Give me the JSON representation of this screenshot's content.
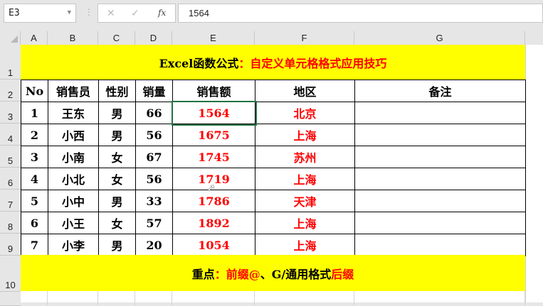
{
  "formula_bar": {
    "name_box": "E3",
    "cancel_icon": "✕",
    "enter_icon": "✓",
    "fx_label": "fx",
    "value": "1564"
  },
  "columns": [
    "A",
    "B",
    "C",
    "D",
    "E",
    "F",
    "G"
  ],
  "rows": [
    "1",
    "2",
    "3",
    "4",
    "5",
    "6",
    "7",
    "8",
    "9",
    "10"
  ],
  "title": {
    "black": "Excel函数公式",
    "red": "：自定义单元格格式应用技巧"
  },
  "headers": [
    "No",
    "销售员",
    "性别",
    "销量",
    "销售额",
    "地区",
    "备注"
  ],
  "records": [
    [
      "1",
      "王东",
      "男",
      "66",
      "1564",
      "北京",
      ""
    ],
    [
      "2",
      "小西",
      "男",
      "56",
      "1675",
      "上海",
      ""
    ],
    [
      "3",
      "小南",
      "女",
      "67",
      "1745",
      "苏州",
      ""
    ],
    [
      "4",
      "小北",
      "女",
      "56",
      "1719",
      "上海",
      ""
    ],
    [
      "5",
      "小中",
      "男",
      "33",
      "1786",
      "天津",
      ""
    ],
    [
      "6",
      "小王",
      "女",
      "57",
      "1892",
      "上海",
      ""
    ],
    [
      "7",
      "小李",
      "男",
      "20",
      "1054",
      "上海",
      ""
    ]
  ],
  "footer": {
    "p1": "重点",
    "p2": "：前缀@ ",
    "p3": "、G/通用格式",
    "p4": "后缀"
  },
  "colors": {
    "highlight": "#ffff00",
    "accent": "#ff0000"
  }
}
